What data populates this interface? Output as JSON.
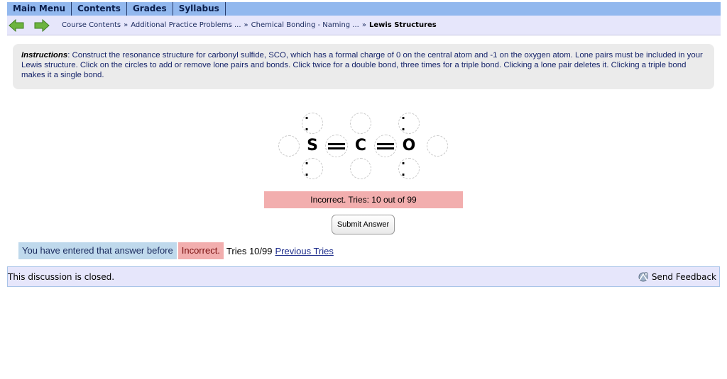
{
  "menu": {
    "items": [
      "Main Menu",
      "Contents",
      "Grades",
      "Syllabus"
    ]
  },
  "breadcrumb": {
    "items": [
      "Course Contents",
      "Additional Practice Problems ...",
      "Chemical Bonding - Naming ..."
    ],
    "separator": "»",
    "current": "Lewis Structures"
  },
  "instructions": {
    "label": "Instructions",
    "text": ": Construct the resonance structure for carbonyl sulfide, SCO, which has a formal charge of 0 on the central atom and -1 on the oxygen atom. Lone pairs must be included in your Lewis structure. Click on the circles to add or remove lone pairs and bonds. Click twice for a double bond, three times for a triple bond. Clicking a lone pair deletes it. Clicking a triple bond makes it a single bond."
  },
  "lewis": {
    "atoms": [
      "S",
      "C",
      "O"
    ],
    "lone_pair_symbol": ". ."
  },
  "status": {
    "message": "Incorrect. Tries: 10 out of 99"
  },
  "submit": {
    "label": "Submit Answer"
  },
  "feedback": {
    "entered_before": "You have entered that answer before",
    "incorrect": "Incorrect.",
    "tries": "Tries 10/99",
    "previous_tries": "Previous Tries"
  },
  "discussion": {
    "closed_text": "This discussion is closed.",
    "send_feedback": "Send Feedback"
  },
  "colors": {
    "menubar": "#92b8ee",
    "crumbbar": "#e6e6fb",
    "incorrect": "#f2aeae",
    "entered_before": "#bfd9ec",
    "arrow_green": "#5da832"
  }
}
